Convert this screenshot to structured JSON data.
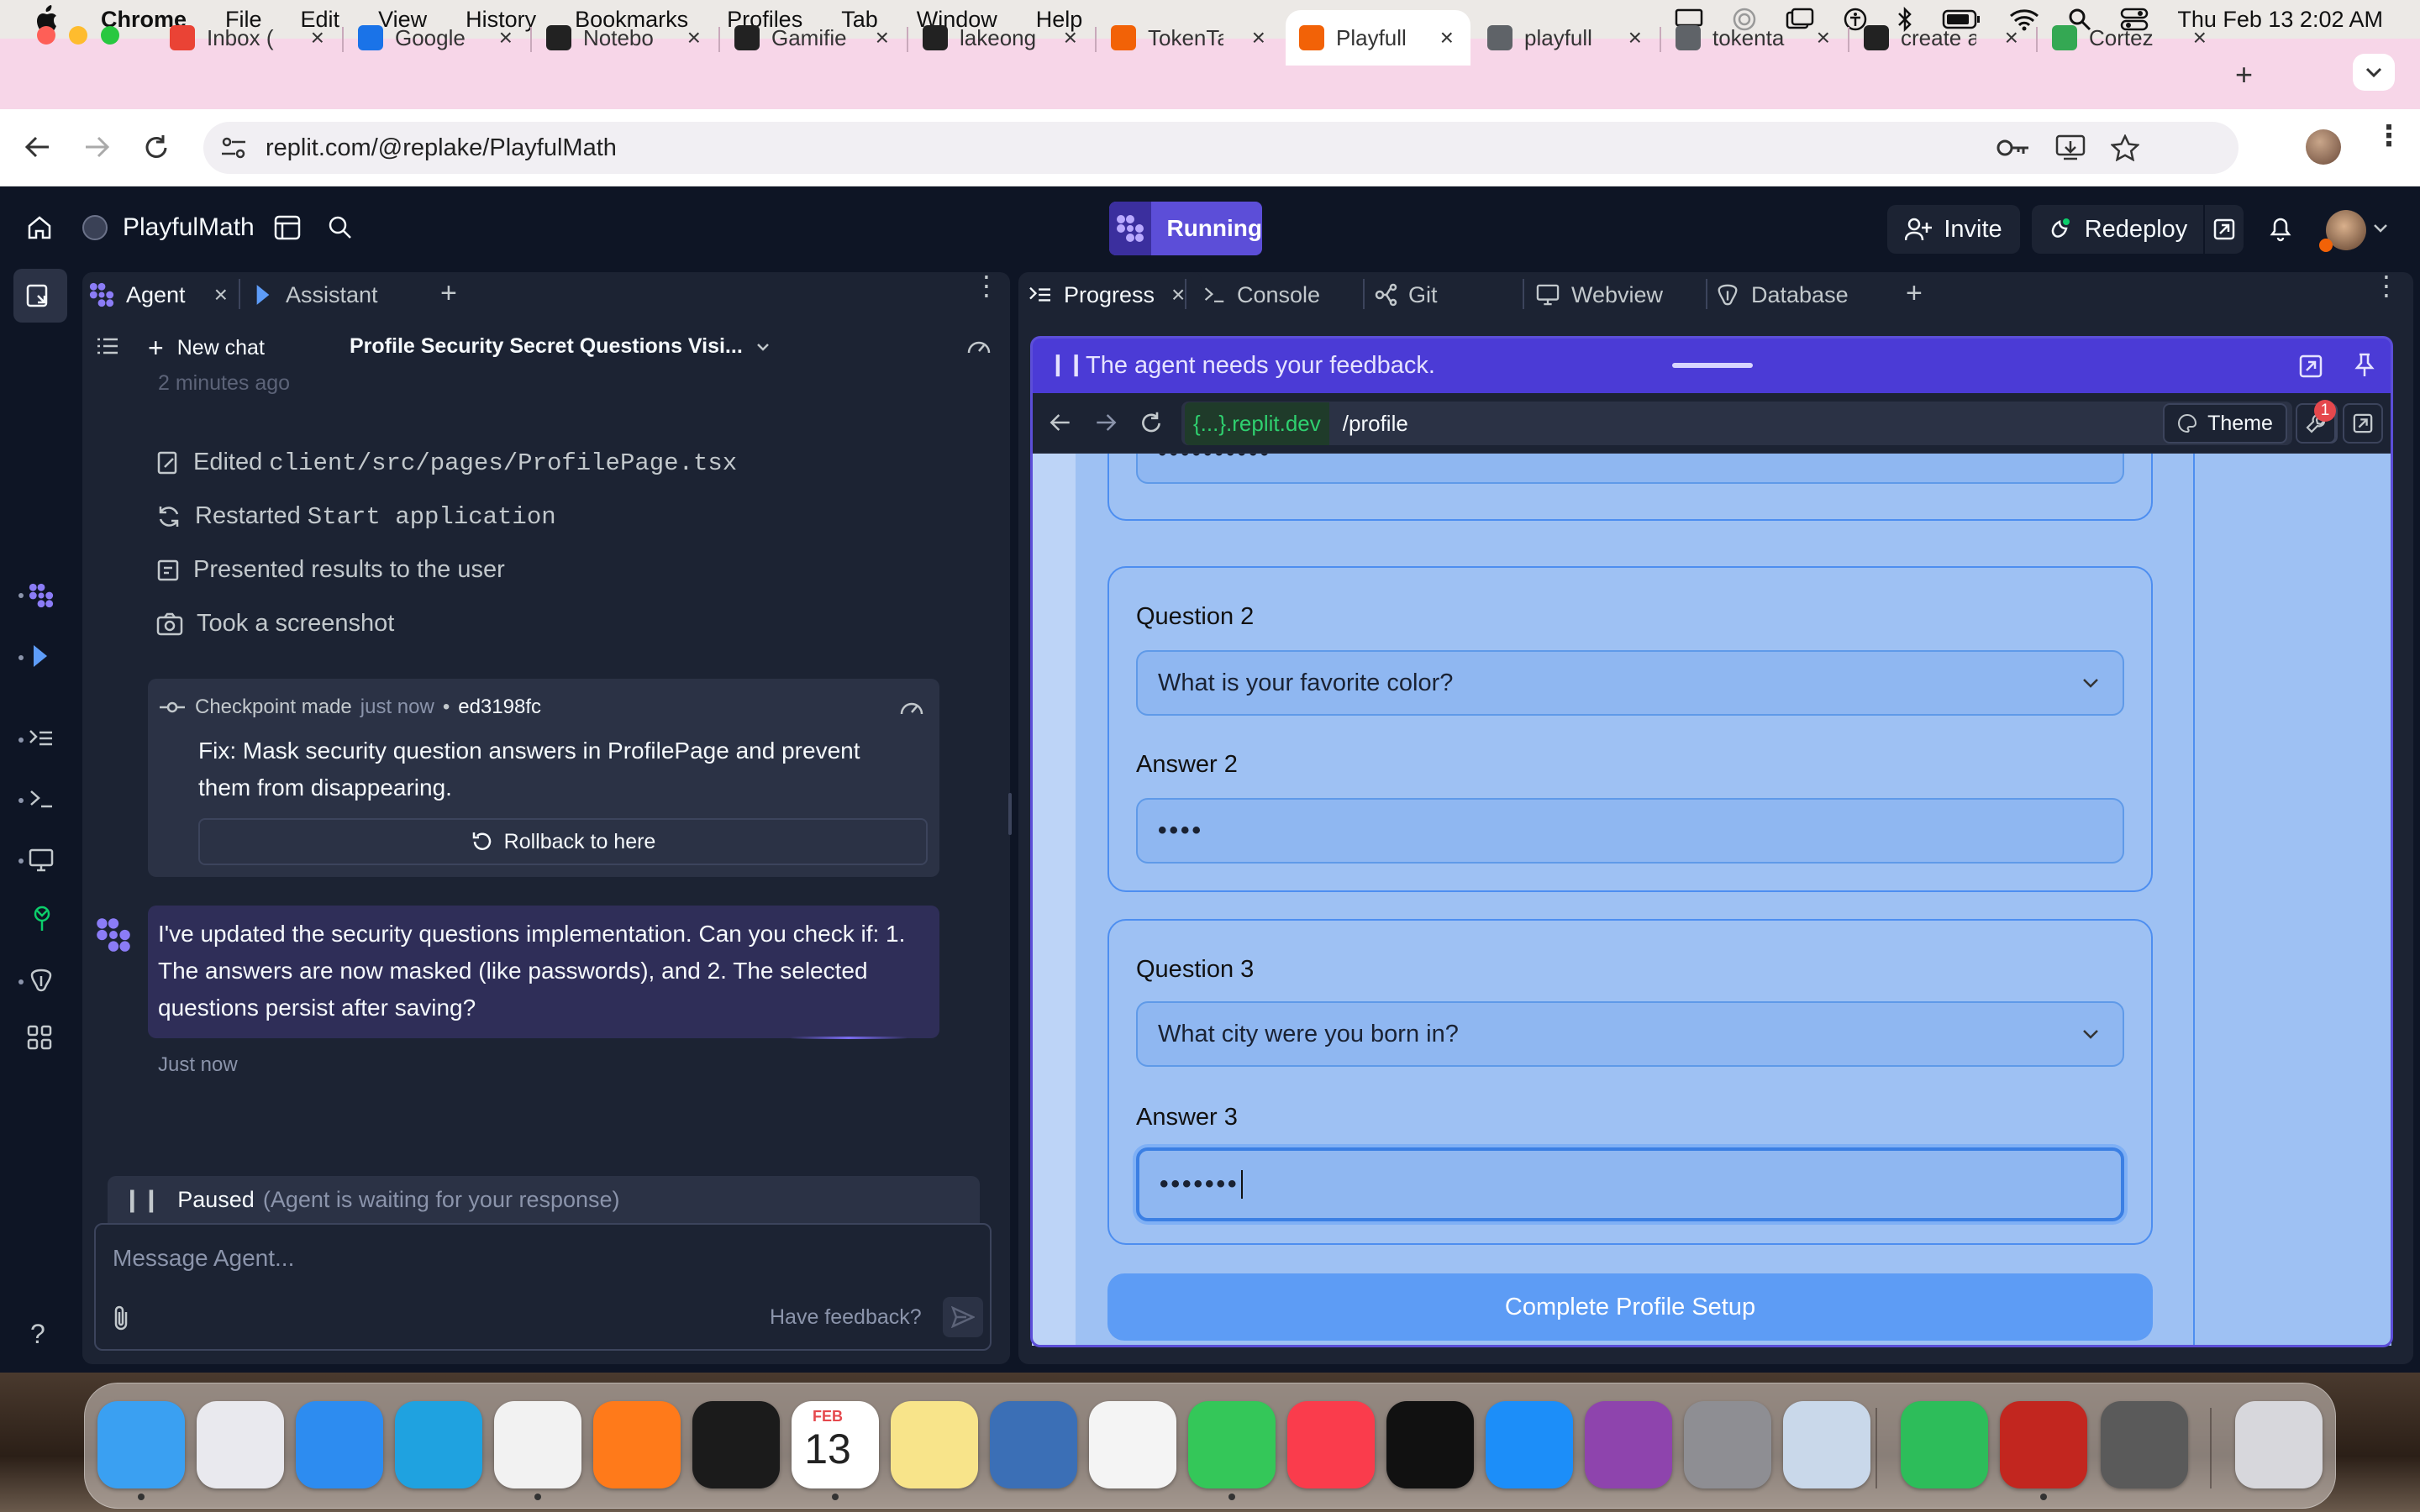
{
  "menubar": {
    "app_name": "Chrome",
    "menus": [
      "File",
      "Edit",
      "View",
      "History",
      "Bookmarks",
      "Profiles",
      "Tab",
      "Window",
      "Help"
    ],
    "datetime": "Thu Feb 13  2:02 AM"
  },
  "browser": {
    "tabs": [
      {
        "title": "Inbox (",
        "favicon_color": "#ea4335"
      },
      {
        "title": "Google",
        "favicon_color": "#1a73e8"
      },
      {
        "title": "Notebo",
        "favicon_color": "#222222"
      },
      {
        "title": "Gamifie",
        "favicon_color": "#222222"
      },
      {
        "title": "lakeong",
        "favicon_color": "#222222"
      },
      {
        "title": "TokenTa",
        "favicon_color": "#f26207"
      },
      {
        "title": "Playfull",
        "favicon_color": "#f26207"
      },
      {
        "title": "playfull",
        "favicon_color": "#5f6368"
      },
      {
        "title": "tokenta",
        "favicon_color": "#5f6368"
      },
      {
        "title": "create a",
        "favicon_color": "#222222"
      },
      {
        "title": "Cortez",
        "favicon_color": "#34a853"
      }
    ],
    "active_tab_index": 6,
    "url": "replit.com/@replake/PlayfulMath"
  },
  "replit": {
    "project_name": "PlayfulMath",
    "run_status": "Running",
    "invite_label": "Invite",
    "redeploy_label": "Redeploy",
    "left_tabs": [
      "Agent",
      "Assistant"
    ],
    "right_tabs": [
      "Progress",
      "Console",
      "Git",
      "Webview",
      "Database"
    ],
    "new_chat_label": "New chat",
    "chat_title": "Profile Security Secret Questions Visi...",
    "chat": {
      "timestamp_top": "2 minutes ago",
      "actions": [
        {
          "verb": "Edited",
          "code": "client/src/pages/ProfilePage.tsx"
        },
        {
          "verb": "Restarted",
          "code": "Start application"
        },
        {
          "verb": "Presented results to the user",
          "code": ""
        },
        {
          "verb": "Took a screenshot",
          "code": ""
        }
      ],
      "checkpoint": {
        "label": "Checkpoint made",
        "time": "just now",
        "sep": "•",
        "hash": "ed3198fc",
        "message": "Fix: Mask security question answers in ProfilePage and prevent them from disappearing.",
        "rollback_label": "Rollback to here"
      },
      "agent_message": "I've updated the security questions implementation. Can you check if: 1. The answers are now masked (like passwords), and 2. The selected questions persist after saving?",
      "agent_message_time": "Just now",
      "paused_label": "Paused",
      "paused_detail": "(Agent is waiting for your response)",
      "composer_placeholder": "Message Agent...",
      "feedback_link": "Have feedback?"
    },
    "preview": {
      "banner": "The agent needs your feedback.",
      "domain": "{...}.replit.dev",
      "path": "/profile",
      "theme_label": "Theme",
      "notif_count": "1",
      "form": {
        "answer1_masked": "••••••••••",
        "question2_label": "Question 2",
        "question2_value": "What is your favorite color?",
        "answer2_label": "Answer 2",
        "answer2_masked": "••••",
        "question3_label": "Question 3",
        "question3_value": "What city were you born in?",
        "answer3_label": "Answer 3",
        "answer3_masked": "•••••••",
        "submit_label": "Complete Profile Setup"
      }
    }
  },
  "dock": {
    "calendar_month": "FEB",
    "calendar_day": "13",
    "apps": [
      "Finder",
      "Launchpad",
      "Safari",
      "Edge",
      "Chrome",
      "Firefox",
      "Screenshot",
      "Calendar",
      "Notes",
      "Cortex",
      "Photos",
      "Messages",
      "Music",
      "Apple TV",
      "App Store",
      "Podcasts",
      "System Settings",
      "Preview",
      "Numbers",
      "Acrobat",
      "Image Capture",
      "Trash"
    ]
  }
}
